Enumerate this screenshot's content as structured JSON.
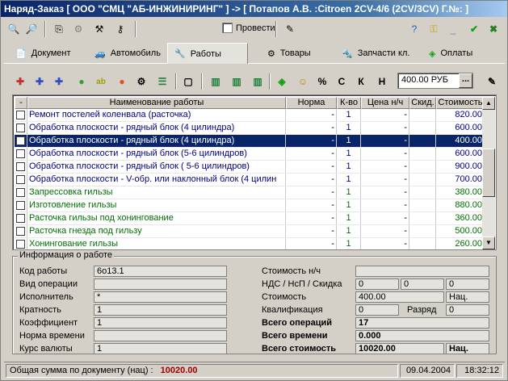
{
  "window": {
    "title": "Наряд-Заказ [ ООО \"СМЦ \"АБ-ИНЖИНИРИНГ\" ] -> [ Потапов А.В.   :Citroen 2CV-4/6 (2CV/3CV) Г.№: ]"
  },
  "toolbar": {
    "post_label": "Провести"
  },
  "tabs": [
    {
      "label": "Документ",
      "icon": "document-icon"
    },
    {
      "label": "Автомобиль",
      "icon": "car-icon"
    },
    {
      "label": "Работы",
      "icon": "wrench-icon"
    },
    {
      "label": "Товары",
      "icon": "gear-icon"
    },
    {
      "label": "Запчасти кл.",
      "icon": "parts-icon"
    },
    {
      "label": "Оплаты",
      "icon": "payment-icon"
    }
  ],
  "toolbar2": {
    "percent": "%",
    "c": "С",
    "k": "К",
    "n": "Н",
    "price": "400.00 РУБ",
    "dots": "..."
  },
  "grid": {
    "headers": [
      "-",
      "Наименование работы",
      "Норма",
      "К-во",
      "Цена н/ч",
      "Скид.",
      "Стоимость"
    ],
    "rows": [
      {
        "name": "Ремонт постелей коленвала (расточка)",
        "norm": "-",
        "qty": "1",
        "price": "-",
        "disc": "",
        "cost": "820.00",
        "color": "#000080"
      },
      {
        "name": "Обработка плоскости  - рядный блок  (4 цилиндра)",
        "norm": "-",
        "qty": "1",
        "price": "-",
        "disc": "",
        "cost": "600.00",
        "color": "#000080"
      },
      {
        "name": "Обработка плоскости  - рядный блок  (4 цилиндра)",
        "norm": "-",
        "qty": "1",
        "price": "-",
        "disc": "",
        "cost": "400.00",
        "color": "#ffffff",
        "selected": true
      },
      {
        "name": "Обработка плоскости  - рядный блок  (5-6 цилиндров)",
        "norm": "-",
        "qty": "1",
        "price": "-",
        "disc": "",
        "cost": "600.00",
        "color": "#000080"
      },
      {
        "name": "Обработка плоскости  - рядный блок  ( 5-6 цилиндров)",
        "norm": "-",
        "qty": "1",
        "price": "-",
        "disc": "",
        "cost": "900.00",
        "color": "#000080"
      },
      {
        "name": "Обработка плоскости - V-обр. или наклонный  блок (4 цилин",
        "norm": "-",
        "qty": "1",
        "price": "-",
        "disc": "",
        "cost": "700.00",
        "color": "#000080"
      },
      {
        "name": "Запрессовка гильзы",
        "norm": "-",
        "qty": "1",
        "price": "-",
        "disc": "",
        "cost": "380.00",
        "color": "#007000"
      },
      {
        "name": "Изготовление гильзы",
        "norm": "-",
        "qty": "1",
        "price": "-",
        "disc": "",
        "cost": "880.00",
        "color": "#007000"
      },
      {
        "name": "Расточка гильзы под хонингование",
        "norm": "-",
        "qty": "1",
        "price": "-",
        "disc": "",
        "cost": "360.00",
        "color": "#007000"
      },
      {
        "name": "Расточка гнезда под гильзу",
        "norm": "-",
        "qty": "1",
        "price": "-",
        "disc": "",
        "cost": "500.00",
        "color": "#007000"
      },
      {
        "name": "Хонингование гильзы",
        "norm": "-",
        "qty": "1",
        "price": "-",
        "disc": "",
        "cost": "260.00",
        "color": "#007000"
      }
    ]
  },
  "info": {
    "legend": "Информация о работе",
    "code_label": "Код работы",
    "code": "6о13.1",
    "op_label": "Вид операции",
    "op": "",
    "exec_label": "Исполнитель",
    "exec": "*",
    "mult_label": "Кратность",
    "mult": "1",
    "coef_label": "Коэффициент",
    "coef": "1",
    "time_label": "Норма времени",
    "time": "",
    "rate_label": "Курс валюты",
    "rate": "1",
    "hourcost_label": "Стоимость н/ч",
    "hourcost": "",
    "vat_label": "НДС / НсП / Скидка",
    "vat1": "0",
    "vat2": "0",
    "vat3": "0",
    "cost_label": "Стоимость",
    "cost": "400.00",
    "cost_unit": "Нац.",
    "qual_label": "Квалификация",
    "qual": "0",
    "grade_label": "Разряд",
    "grade": "0",
    "total_ops_label": "Всего операций",
    "total_ops": "17",
    "total_time_label": "Всего времени",
    "total_time": "0.000",
    "total_cost_label": "Всего стоимость",
    "total_cost": "10020.00",
    "total_unit": "Нац."
  },
  "status": {
    "sum_label": "Общая сумма по документу (нац) :",
    "sum": "10020.00",
    "date": "09.04.2004",
    "time": "18:32:12"
  }
}
